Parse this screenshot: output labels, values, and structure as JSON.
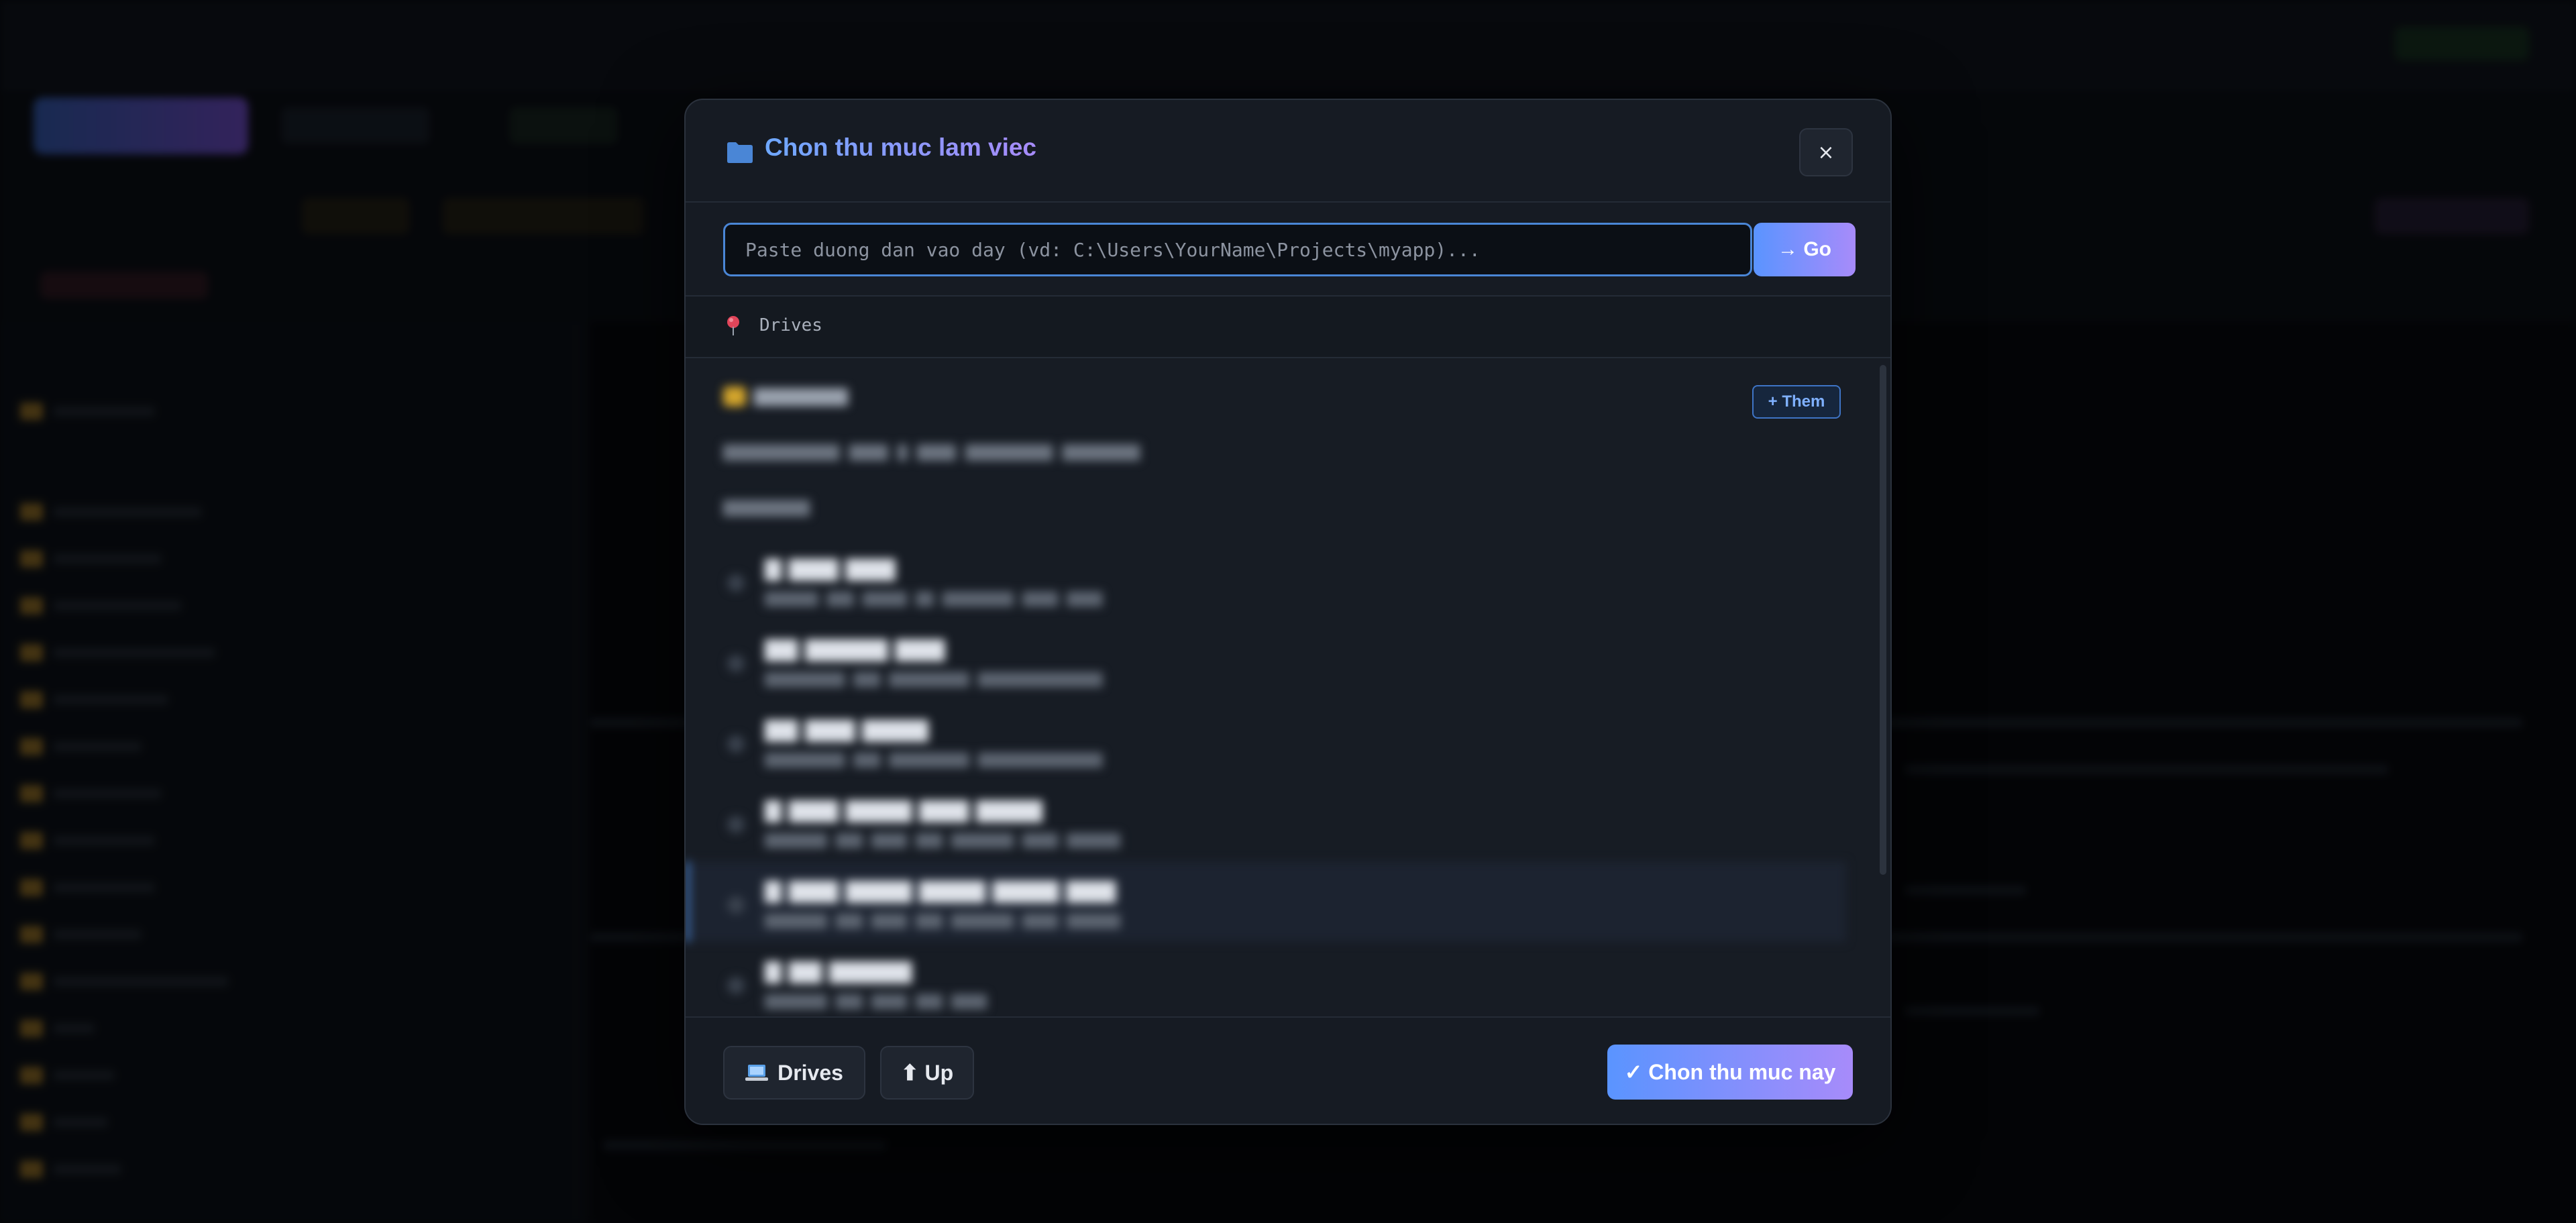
{
  "modal": {
    "title": "Chon thu muc lam viec",
    "close_label": "×",
    "path_input_placeholder": "Paste duong dan vao day (vd: C:\\Users\\YourName\\Projects\\myapp)...",
    "path_input_value": "",
    "go_label": "→ Go",
    "breadcrumb": "Drives",
    "add_label": "+ Them",
    "footer": {
      "drives_label": "Drives",
      "up_label": "⬆ Up",
      "confirm_label": "✓ Chon thu muc nay"
    }
  },
  "colors": {
    "accent_start": "#5a94ff",
    "accent_end": "#a78bfa",
    "modal_bg": "#161b23",
    "input_border": "#4a86d6",
    "folder_icon": "#4a86d6"
  },
  "icons": {
    "header": "folder-icon",
    "breadcrumb": "pin-icon",
    "drives": "laptop-icon"
  }
}
